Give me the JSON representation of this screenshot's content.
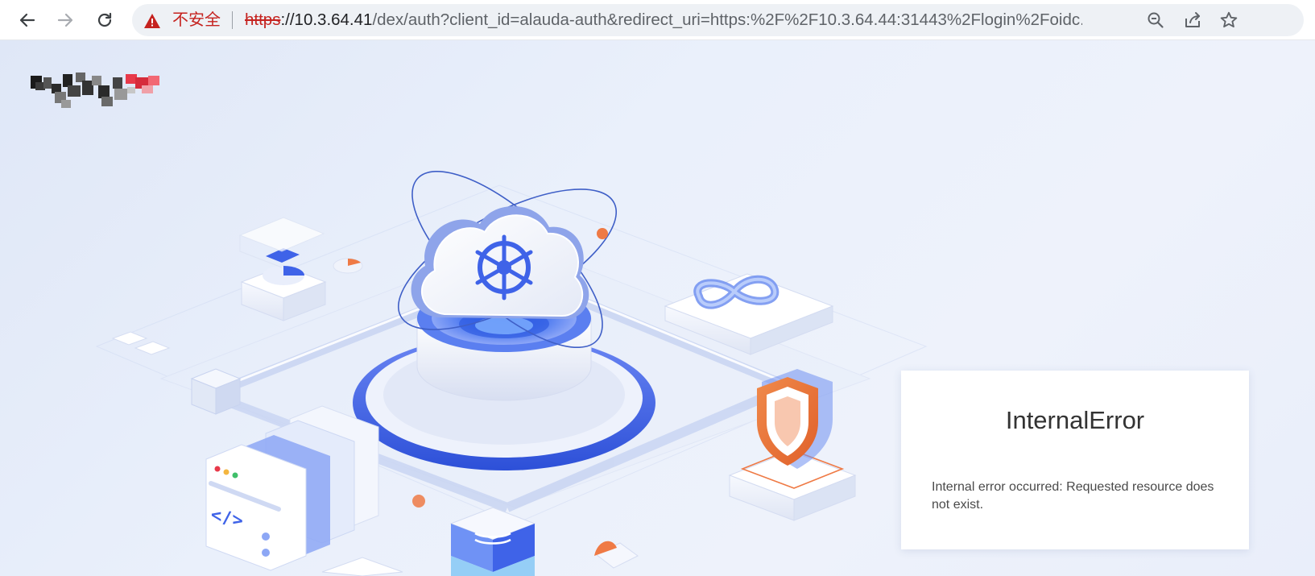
{
  "browser": {
    "security_label": "不安全",
    "url": {
      "scheme": "https",
      "host": "://10.3.64.41",
      "path": "/dex/auth?client_id=alauda-auth&redirect_uri=https:%2F%2F10.3.64.44:31443%2Flogin%2Foidc..."
    },
    "icons": {
      "back": "back-arrow-icon",
      "forward": "forward-arrow-icon",
      "reload": "reload-icon",
      "warning": "warning-triangle-icon",
      "zoom": "zoom-out-icon",
      "share": "share-icon",
      "bookmark": "star-icon"
    }
  },
  "page": {
    "logo": "pixelated-logo",
    "error": {
      "title": "InternalError",
      "message": "Internal error occurred: Requested resource does not exist."
    }
  },
  "colors": {
    "insecure_red": "#c5221f",
    "accent_blue": "#3f63e8",
    "background": "#e6edfa"
  }
}
